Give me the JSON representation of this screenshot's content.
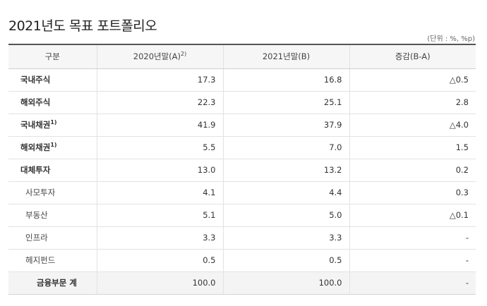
{
  "title": "2021년도 목표 포트폴리오",
  "unit": "(단위 : %, %p)",
  "headers": {
    "category": "구분",
    "col_a": "2020년말(A)",
    "col_a_note": "2)",
    "col_b": "2021년말(B)",
    "col_diff": "증감(B-A)"
  },
  "rows": [
    {
      "label": "국내주식",
      "note": "",
      "a": "17.3",
      "b": "16.8",
      "diff": "△0.5"
    },
    {
      "label": "해외주식",
      "note": "",
      "a": "22.3",
      "b": "25.1",
      "diff": "2.8"
    },
    {
      "label": "국내채권",
      "note": "1)",
      "a": "41.9",
      "b": "37.9",
      "diff": "△4.0"
    },
    {
      "label": "해외채권",
      "note": "1)",
      "a": "5.5",
      "b": "7.0",
      "diff": "1.5"
    },
    {
      "label": "대체투자",
      "note": "",
      "a": "13.0",
      "b": "13.2",
      "diff": "0.2"
    },
    {
      "label": "사모투자",
      "note": "",
      "a": "4.1",
      "b": "4.4",
      "diff": "0.3"
    },
    {
      "label": "부동산",
      "note": "",
      "a": "5.1",
      "b": "5.0",
      "diff": "△0.1"
    },
    {
      "label": "인프라",
      "note": "",
      "a": "3.3",
      "b": "3.3",
      "diff": "-"
    },
    {
      "label": "헤지펀드",
      "note": "",
      "a": "0.5",
      "b": "0.5",
      "diff": "-"
    }
  ],
  "total": {
    "label": "금융부문 계",
    "a": "100.0",
    "b": "100.0",
    "diff": "-"
  }
}
